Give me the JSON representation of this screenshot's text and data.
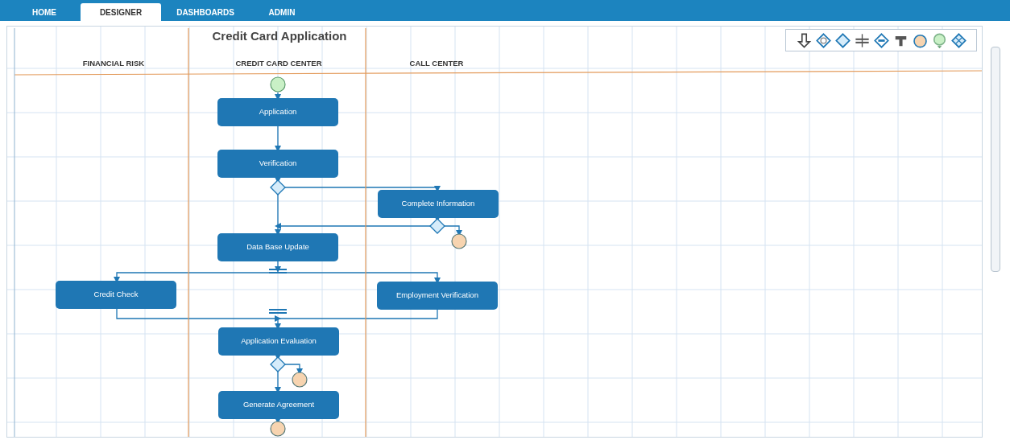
{
  "tabs": [
    {
      "label": "HOME",
      "selected": false
    },
    {
      "label": "DESIGNER",
      "selected": true
    },
    {
      "label": "DASHBOARDS",
      "selected": false
    },
    {
      "label": "ADMIN",
      "selected": false
    }
  ],
  "diagram": {
    "title": "Credit Card Application",
    "lanes": [
      "FINANCIAL RISK",
      "CREDIT CARD CENTER",
      "CALL CENTER"
    ],
    "nodes": [
      {
        "kind": "start"
      },
      {
        "kind": "task",
        "label": "Application"
      },
      {
        "kind": "task",
        "label": "Verification"
      },
      {
        "kind": "decision"
      },
      {
        "kind": "task",
        "label": "Complete Information"
      },
      {
        "kind": "decision"
      },
      {
        "kind": "end"
      },
      {
        "kind": "task",
        "label": "Data Base Update"
      },
      {
        "kind": "fork"
      },
      {
        "kind": "task",
        "label": "Credit Check"
      },
      {
        "kind": "task",
        "label": "Employment Verification"
      },
      {
        "kind": "fork"
      },
      {
        "kind": "task",
        "label": "Application Evaluation"
      },
      {
        "kind": "decision"
      },
      {
        "kind": "end"
      },
      {
        "kind": "task",
        "label": "Generate Agreement"
      },
      {
        "kind": "end"
      }
    ]
  }
}
